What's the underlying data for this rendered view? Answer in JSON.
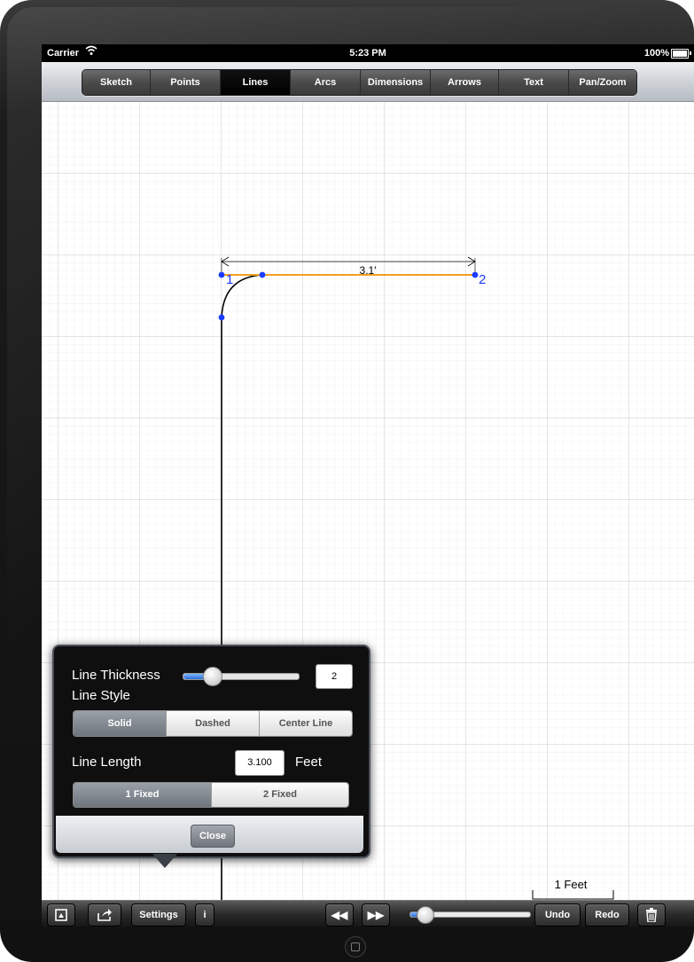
{
  "status": {
    "carrier": "Carrier",
    "time": "5:23 PM",
    "battery": "100%"
  },
  "tabs": [
    {
      "label": "Sketch"
    },
    {
      "label": "Points"
    },
    {
      "label": "Lines"
    },
    {
      "label": "Arcs"
    },
    {
      "label": "Dimensions"
    },
    {
      "label": "Arrows"
    },
    {
      "label": "Text"
    },
    {
      "label": "Pan/Zoom"
    }
  ],
  "active_tab": "Lines",
  "drawing": {
    "dimension_label": "3.1′",
    "point1_label": "1",
    "point2_label": "2",
    "scale_label": "1 Feet",
    "line_color": "#f0a01e",
    "point_color": "#1a3cff"
  },
  "popover": {
    "thickness_label": "Line Thickness",
    "thickness_value": "2",
    "thickness_slider_level": 0.2,
    "style_label": "Line Style",
    "style_options": [
      "Solid",
      "Dashed",
      "Center Line"
    ],
    "style_selected": "Solid",
    "length_label": "Line Length",
    "length_value": "3.100",
    "length_unit": "Feet",
    "fixed_options": [
      "1 Fixed",
      "2 Fixed"
    ],
    "fixed_selected": "1 Fixed",
    "close_label": "Close"
  },
  "toolbar": {
    "settings_label": "Settings",
    "info_label": "i",
    "undo_label": "Undo",
    "redo_label": "Redo",
    "zoom_slider_level": 0.13
  }
}
